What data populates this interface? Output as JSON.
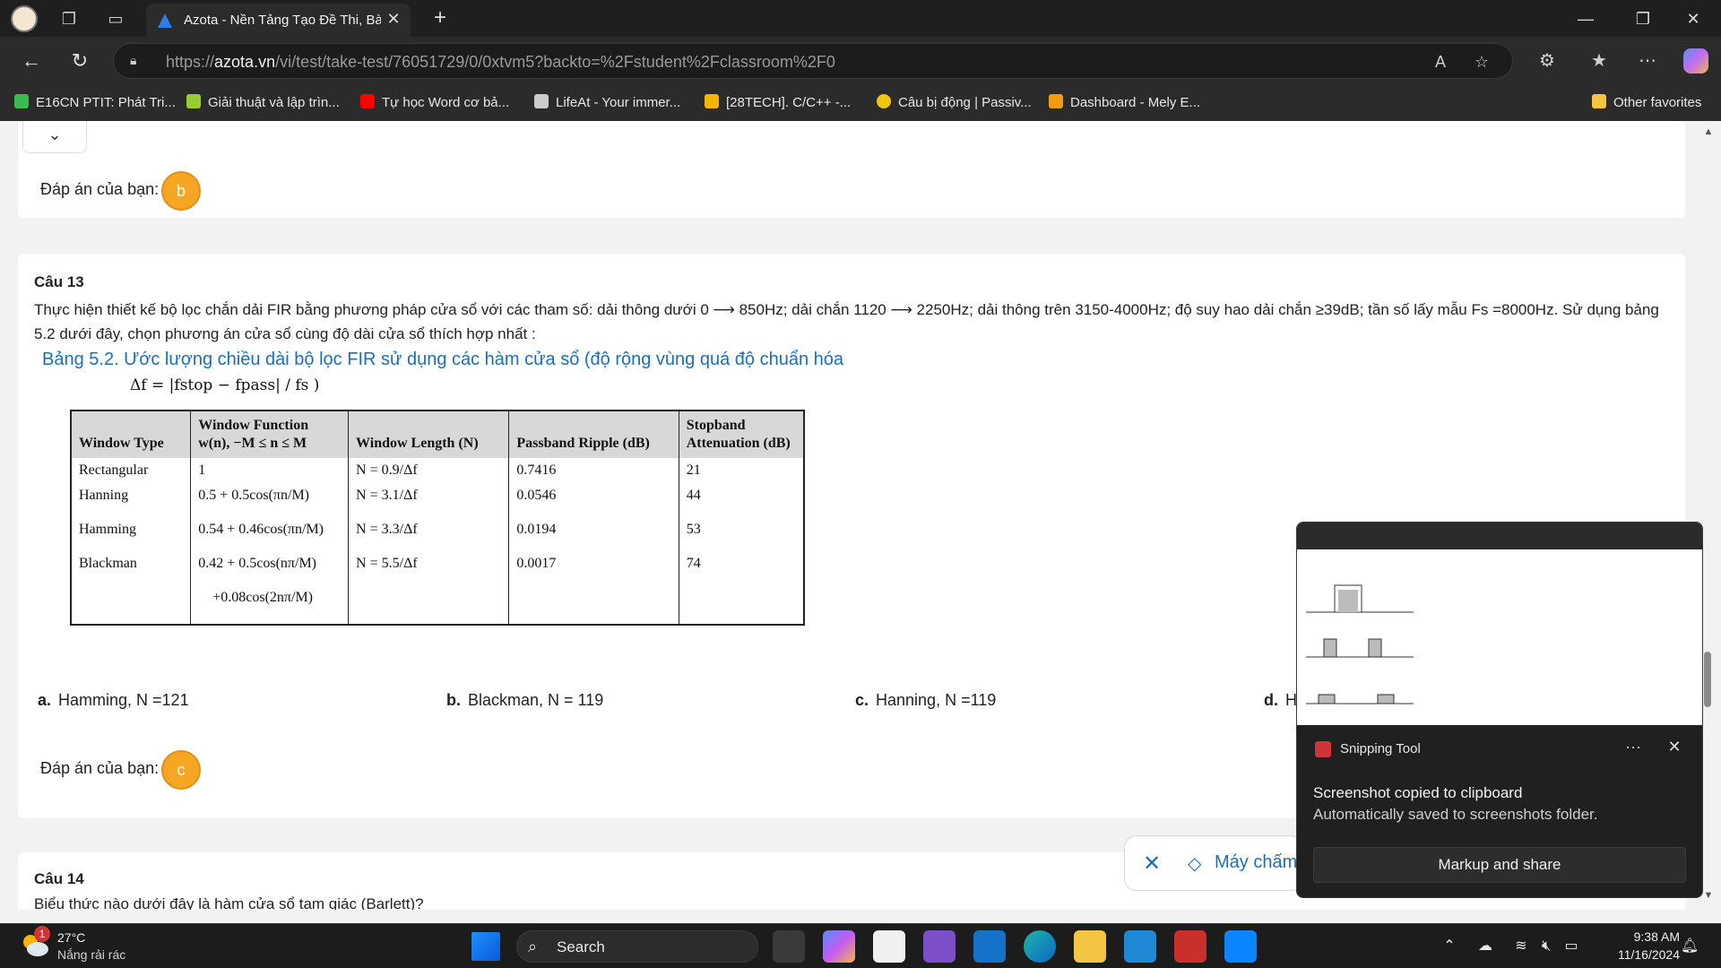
{
  "browser": {
    "tab_title": "Azota - Nền Tảng Tạo Đề Thi, Bài",
    "url_prefix": "https://",
    "url_domain": "azota.vn",
    "url_path": "/vi/test/take-test/76051729/0/0xtvm5?backto=%2Fstudent%2Fclassroom%2F0",
    "favorites": [
      {
        "label": "E16CN PTIT: Phát Tri...",
        "color": "#3fb950"
      },
      {
        "label": "Giải thuật và lập trìn...",
        "color": "#9acd32"
      },
      {
        "label": "Tự học Word cơ bả...",
        "color": "#ff0000"
      },
      {
        "label": "LifeAt - Your immer...",
        "color": "#cccccc"
      },
      {
        "label": "[28TECH]. C/C++ -...",
        "color": "#f4b400"
      },
      {
        "label": "Câu bị động | Passiv...",
        "color": "#f1c40f"
      },
      {
        "label": "Dashboard - Mely E...",
        "color": "#f39c12"
      }
    ],
    "other_favorites": "Other favorites"
  },
  "page": {
    "prev_answer": {
      "label": "Đáp án của bạn:",
      "value": "b"
    },
    "q13": {
      "title": "Câu 13",
      "text_line1": "Thực hiện thiết kế bộ lọc chắn dải FIR bằng phương pháp cửa sổ với các tham số: dải thông dưới 0 ⟶ 850Hz; dải chắn 1120 ⟶ 2250Hz; dải thông trên 3150-4000Hz; độ suy hao dải chắn ≥39dB; tần số lấy mẫu Fs =8000Hz. Sử dụng bảng",
      "text_line2": "5.2 dưới đây, chọn phương án cửa sổ cùng độ dài cửa sổ thích hợp nhất :",
      "caption": "Bảng 5.2. Ước lượng chiều dài bộ lọc FIR sử dụng các hàm cửa sổ (độ rộng vùng quá độ chuẩn hóa",
      "formula": "Δf = |fstop − fpass| / fs )",
      "table": {
        "headers": [
          "Window Type",
          "Window Function w(n), −M ≤ n ≤ M",
          "Window Length (N)",
          "Passband Ripple (dB)",
          "Stopband Attenuation (dB)"
        ],
        "rows": [
          [
            "Rectangular",
            "1",
            "N = 0.9/Δf",
            "0.7416",
            "21"
          ],
          [
            "Hanning",
            "0.5 + 0.5cos(πn/M)",
            "N = 3.1/Δf",
            "0.0546",
            "44"
          ],
          [
            "Hamming",
            "0.54 + 0.46cos(πn/M)",
            "N = 3.3/Δf",
            "0.0194",
            "53"
          ],
          [
            "Blackman",
            "0.42 + 0.5cos(nπ/M)",
            "N = 5.5/Δf",
            "0.0017",
            "74"
          ],
          [
            "",
            "+0.08cos(2nπ/M)",
            "",
            "",
            ""
          ]
        ]
      },
      "options": [
        {
          "key": "a.",
          "text": "Hamming, N =121"
        },
        {
          "key": "b.",
          "text": "Blackman, N = 119"
        },
        {
          "key": "c.",
          "text": "Hanning, N =119"
        },
        {
          "key": "d.",
          "text": "H"
        }
      ],
      "answer": {
        "label": "Đáp án của bạn:",
        "value": "c"
      }
    },
    "q14": {
      "title": "Câu 14",
      "text": "Biểu thức nào dưới đây là hàm cửa sổ tam giác (Barlett)?"
    },
    "grader": {
      "close": "✕",
      "label": "Máy chấm"
    }
  },
  "toast": {
    "app": "Snipping Tool",
    "title": "Screenshot copied to clipboard",
    "subtitle": "Automatically saved to screenshots folder.",
    "button": "Markup and share",
    "more": "···",
    "close": "✕"
  },
  "taskbar": {
    "temp": "27°C",
    "weather": "Nắng rải rác",
    "weather_badge": "1",
    "search": "Search",
    "time": "9:38 AM",
    "date": "11/16/2024"
  },
  "colors": {
    "accent": "#1d6fb8",
    "badge": "#f5a623",
    "dark": "#202020"
  }
}
